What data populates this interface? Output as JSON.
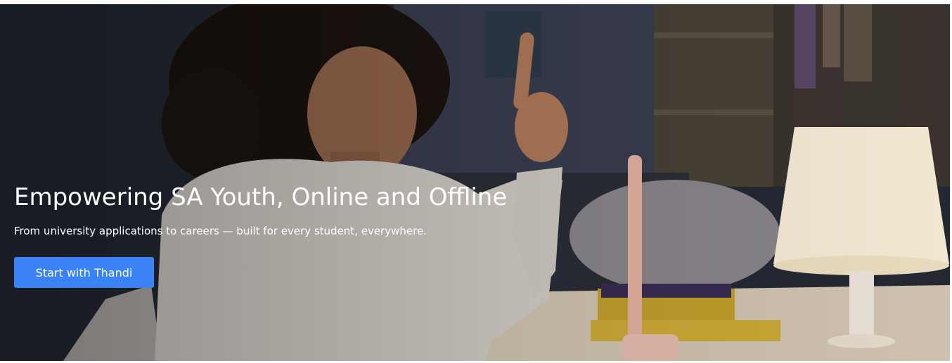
{
  "hero": {
    "background_image": "girl-studying-at-desk-with-lamp-photo",
    "title": "Empowering SA Youth, Online and Offline",
    "subtitle": "From university applications to careers — built for every student, everywhere.",
    "cta_label": "Start with Thandi"
  },
  "colors": {
    "cta_background": "#3b82f6",
    "text": "#ffffff"
  }
}
